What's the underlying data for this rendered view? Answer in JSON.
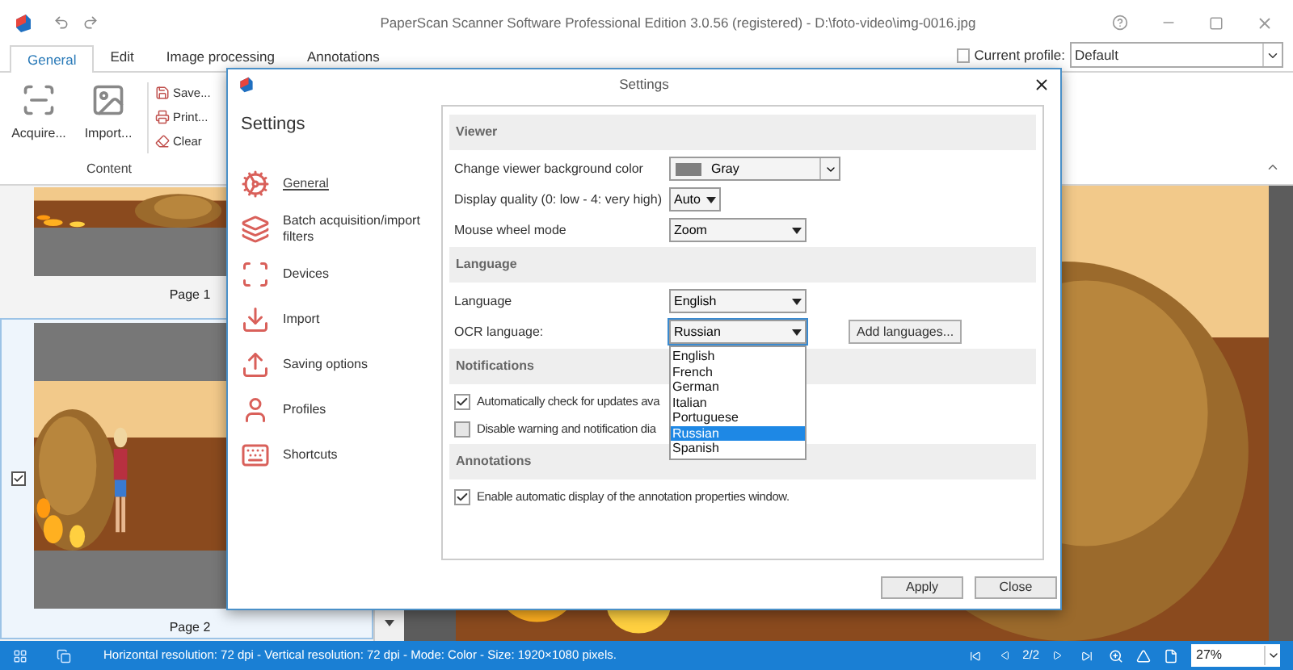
{
  "window": {
    "title": "PaperScan Scanner Software Professional Edition 3.0.56 (registered) - D:\\foto-video\\img-0016.jpg"
  },
  "ribbon": {
    "tabs": [
      {
        "label": "General",
        "selected": true
      },
      {
        "label": "Edit",
        "selected": false
      },
      {
        "label": "Image processing",
        "selected": false
      },
      {
        "label": "Annotations",
        "selected": false
      }
    ],
    "profile": {
      "label": "Current profile:",
      "value": "Default",
      "checked": false
    },
    "group": {
      "label": "Content",
      "large_buttons": [
        {
          "label": "Acquire...",
          "kind": "acquire"
        },
        {
          "label": "Import...",
          "kind": "import"
        }
      ],
      "small_buttons": [
        {
          "label": "Save...",
          "kind": "save"
        },
        {
          "label": "Print...",
          "kind": "print"
        },
        {
          "label": "Clear",
          "kind": "clear"
        }
      ]
    }
  },
  "thumbnails": [
    {
      "label": "Page 1",
      "checked": false,
      "selected": false
    },
    {
      "label": "Page 2",
      "checked": true,
      "selected": true
    }
  ],
  "dialog": {
    "title": "Settings",
    "heading": "Settings",
    "nav": [
      {
        "label": "General",
        "kind": "general",
        "selected": true
      },
      {
        "label": "Batch acquisition/import filters",
        "kind": "batch",
        "selected": false
      },
      {
        "label": "Devices",
        "kind": "devices",
        "selected": false
      },
      {
        "label": "Import",
        "kind": "import",
        "selected": false
      },
      {
        "label": "Saving options",
        "kind": "saving",
        "selected": false
      },
      {
        "label": "Profiles",
        "kind": "profiles",
        "selected": false
      },
      {
        "label": "Shortcuts",
        "kind": "shortcuts",
        "selected": false
      }
    ],
    "sections": [
      {
        "title": "Viewer",
        "rows": [
          {
            "kind": "color_select",
            "label": "Change viewer background color",
            "value": "Gray"
          },
          {
            "kind": "compact_select",
            "label": "Display quality (0: low - 4: very high)",
            "value": "Auto"
          },
          {
            "kind": "select",
            "label": "Mouse wheel mode",
            "value": "Zoom"
          }
        ]
      },
      {
        "title": "Language",
        "rows": [
          {
            "kind": "select",
            "label": "Language",
            "value": "English"
          },
          {
            "kind": "select",
            "label": "OCR language:",
            "value": "Russian",
            "button": "Add languages...",
            "expanded": true,
            "options": [
              {
                "label": "English",
                "selected": false
              },
              {
                "label": "French",
                "selected": false
              },
              {
                "label": "German",
                "selected": false
              },
              {
                "label": "Italian",
                "selected": false
              },
              {
                "label": "Portuguese",
                "selected": false
              },
              {
                "label": "Russian",
                "selected": true
              },
              {
                "label": "Spanish",
                "selected": false
              }
            ]
          }
        ]
      },
      {
        "title": "Notifications",
        "rows": [
          {
            "kind": "checkbox",
            "label": "Automatically check for updates ava",
            "checked": true
          },
          {
            "kind": "checkbox",
            "label": "Disable warning and notification dia",
            "checked": false
          }
        ]
      },
      {
        "title": "Annotations",
        "rows": [
          {
            "kind": "checkbox",
            "label": "Enable automatic display of the annotation properties window.",
            "checked": true
          }
        ]
      }
    ],
    "buttons": [
      "Apply",
      "Close"
    ]
  },
  "status_bar": {
    "text": "Horizontal resolution:  72 dpi - Vertical resolution:  72 dpi - Mode: Color - Size: 1920×1080 pixels.",
    "page": "2/2",
    "zoom": "27%"
  }
}
